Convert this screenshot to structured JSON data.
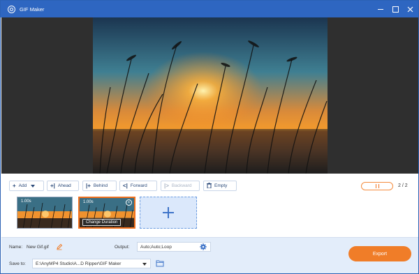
{
  "window": {
    "title": "GIF Maker"
  },
  "toolbar": {
    "add": "Add",
    "ahead": "Ahead",
    "behind": "Behind",
    "forward": "Forward",
    "backward": "Backward",
    "empty": "Empty"
  },
  "playback": {
    "frame_counter": "2 / 2"
  },
  "frames": [
    {
      "duration": "1.00s"
    },
    {
      "duration": "1.00s",
      "change_duration": "Change Duration"
    }
  ],
  "settings": {
    "name_label": "Name:",
    "name_value": "New Gif.gif",
    "output_label": "Output:",
    "output_value": "Auto;Auto;Loop",
    "save_label": "Save to:",
    "save_path": "E:\\AnyMP4 Studio\\A...D Ripper\\GIF Maker",
    "export": "Export"
  },
  "colors": {
    "accent": "#f07d28",
    "titlebar": "#2e66c1",
    "preview_bg": "#2f2f2f"
  }
}
